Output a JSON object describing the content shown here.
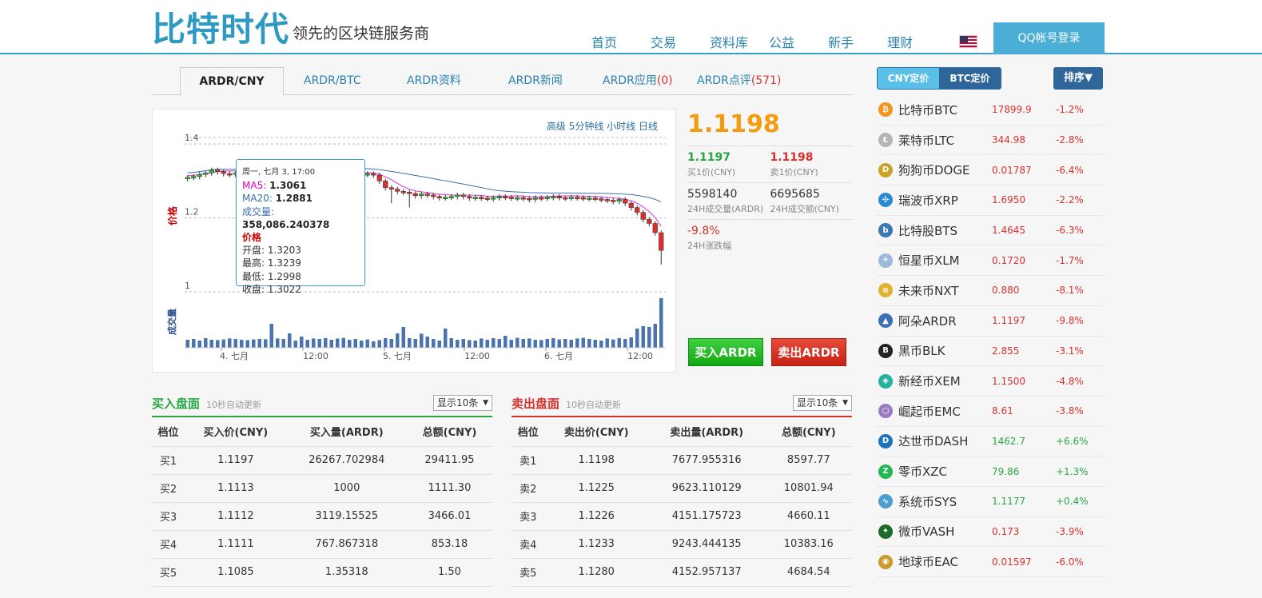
{
  "header": {
    "logo_main": "比特时代",
    "logo_sub": "领先的区块链服务商",
    "nav": [
      "首页",
      "交易",
      "资料库",
      "公益",
      "新手",
      "理财"
    ],
    "login_label": "QQ帐号登录"
  },
  "tabs": [
    {
      "label": "ARDR/CNY",
      "count": ""
    },
    {
      "label": "ARDR/BTC",
      "count": ""
    },
    {
      "label": "ARDR资料",
      "count": ""
    },
    {
      "label": "ARDR新闻",
      "count": ""
    },
    {
      "label": "ARDR应用",
      "count": "(0)"
    },
    {
      "label": "ARDR点评",
      "count": "(571)"
    }
  ],
  "chart": {
    "modes": "高级 5分钟线 小时线 日线",
    "price_axis_label": "价格",
    "volume_axis_label": "成交量",
    "tooltip": {
      "date": "周一, 七月 3, 17:00",
      "ma5_label": "MA5:",
      "ma5": "1.3061",
      "ma20_label": "MA20:",
      "ma20": "1.2881",
      "volume_label": "成交量:",
      "volume": "358,086.240378",
      "price_title": "价格",
      "open": "开盘: 1.3203",
      "high": "最高: 1.3239",
      "low": "最低: 1.2998",
      "close": "收盘: 1.3022"
    }
  },
  "chart_data": {
    "type": "candlestick",
    "title": "",
    "y_ticks": [
      1,
      1.2,
      1.4
    ],
    "ylim": [
      1.0,
      1.45
    ],
    "x_ticks": [
      "4. 七月",
      "12:00",
      "5. 七月",
      "12:00",
      "6. 七月",
      "12:00"
    ],
    "ma_series": [
      {
        "name": "MA5",
        "color": "#dd33cc"
      },
      {
        "name": "MA20",
        "color": "#3a6fb0"
      }
    ],
    "close": [
      1.31,
      1.312,
      1.318,
      1.322,
      1.33,
      1.325,
      1.32,
      1.318,
      1.322,
      1.326,
      1.33,
      1.334,
      1.332,
      1.33,
      1.328,
      1.325,
      1.322,
      1.32,
      1.318,
      1.32,
      1.322,
      1.318,
      1.315,
      1.312,
      1.316,
      1.318,
      1.32,
      1.318,
      1.316,
      1.318,
      1.32,
      1.316,
      1.3,
      1.282,
      1.278,
      1.272,
      1.27,
      1.266,
      1.26,
      1.265,
      1.262,
      1.258,
      1.255,
      1.256,
      1.258,
      1.262,
      1.258,
      1.254,
      1.256,
      1.254,
      1.252,
      1.255,
      1.258,
      1.256,
      1.254,
      1.255,
      1.253,
      1.25,
      1.255,
      1.254,
      1.256,
      1.258,
      1.255,
      1.254,
      1.256,
      1.255,
      1.253,
      1.254,
      1.252,
      1.25,
      1.248,
      1.245,
      1.25,
      1.24,
      1.228,
      1.215,
      1.196,
      1.185,
      1.16,
      1.112
    ],
    "volume": [
      50,
      55,
      45,
      60,
      50,
      48,
      52,
      58,
      55,
      50,
      48,
      52,
      55,
      53,
      150,
      58,
      55,
      90,
      45,
      70,
      50,
      58,
      55,
      60,
      50,
      58,
      62,
      50,
      55,
      45,
      52,
      40,
      48,
      60,
      55,
      90,
      130,
      60,
      55,
      88,
      70,
      55,
      45,
      120,
      60,
      50,
      55,
      48,
      45,
      58,
      50,
      60,
      55,
      75,
      50,
      62,
      55,
      58,
      50,
      48,
      55,
      60,
      52,
      55,
      50,
      58,
      62,
      55,
      50,
      45,
      58,
      52,
      60,
      55,
      65,
      120,
      135,
      130,
      150,
      310
    ]
  },
  "price_panel": {
    "last": "1.1198",
    "bid": "1.1197",
    "bid_label": "买1价(CNY)",
    "ask": "1.1198",
    "ask_label": "卖1价(CNY)",
    "vol": "5598140",
    "vol_label": "24H成交量(ARDR)",
    "amt": "6695685",
    "amt_label": "24H成交额(CNY)",
    "change": "-9.8%",
    "change_label": "24H涨跌幅",
    "buy_button": "买入ARDR",
    "sell_button": "卖出ARDR"
  },
  "buy_book": {
    "title": "买入盘面",
    "note": "10秒自动更新",
    "select": "显示10条",
    "headers": [
      "档位",
      "买入价(CNY)",
      "买入量(ARDR)",
      "总额(CNY)"
    ],
    "rows": [
      [
        "买1",
        "1.1197",
        "26267.702984",
        "29411.95"
      ],
      [
        "买2",
        "1.1113",
        "1000",
        "1111.30"
      ],
      [
        "买3",
        "1.1112",
        "3119.15525",
        "3466.01"
      ],
      [
        "买4",
        "1.1111",
        "767.867318",
        "853.18"
      ],
      [
        "买5",
        "1.1085",
        "1.35318",
        "1.50"
      ]
    ]
  },
  "sell_book": {
    "title": "卖出盘面",
    "note": "10秒自动更新",
    "select": "显示10条",
    "headers": [
      "档位",
      "卖出价(CNY)",
      "卖出量(ARDR)",
      "总额(CNY)"
    ],
    "rows": [
      [
        "卖1",
        "1.1198",
        "7677.955316",
        "8597.77"
      ],
      [
        "卖2",
        "1.1225",
        "9623.110129",
        "10801.94"
      ],
      [
        "卖3",
        "1.1226",
        "4151.175723",
        "4660.11"
      ],
      [
        "卖4",
        "1.1233",
        "9243.444135",
        "10383.16"
      ],
      [
        "卖5",
        "1.1280",
        "4152.957137",
        "4684.54"
      ]
    ]
  },
  "sidebar": {
    "toggle": [
      "CNY定价",
      "BTC定价"
    ],
    "sort_label": "排序▼",
    "coins": [
      {
        "name": "比特币BTC",
        "price": "17899.9",
        "change": "-1.2%",
        "up": false,
        "icon": "bitcoin-icon",
        "color": "#f7931a",
        "glyph": "₿"
      },
      {
        "name": "莱特币LTC",
        "price": "344.98",
        "change": "-2.8%",
        "up": false,
        "icon": "litecoin-icon",
        "color": "#b5b5b5",
        "glyph": "Ł"
      },
      {
        "name": "狗狗币DOGE",
        "price": "0.01787",
        "change": "-6.4%",
        "up": false,
        "icon": "dogecoin-icon",
        "color": "#c9a227",
        "glyph": "D"
      },
      {
        "name": "瑞波币XRP",
        "price": "1.6950",
        "change": "-2.2%",
        "up": false,
        "icon": "ripple-icon",
        "color": "#2a8ad4",
        "glyph": "✣"
      },
      {
        "name": "比特股BTS",
        "price": "1.4645",
        "change": "-6.3%",
        "up": false,
        "icon": "bitshares-icon",
        "color": "#3778b5",
        "glyph": "b"
      },
      {
        "name": "恒星币XLM",
        "price": "0.1720",
        "change": "-1.7%",
        "up": false,
        "icon": "stellar-icon",
        "color": "#9ab8d8",
        "glyph": "✈"
      },
      {
        "name": "未来币NXT",
        "price": "0.880",
        "change": "-8.1%",
        "up": false,
        "icon": "nxt-icon",
        "color": "#e0b030",
        "glyph": "≋"
      },
      {
        "name": "阿朵ARDR",
        "price": "1.1197",
        "change": "-9.8%",
        "up": false,
        "icon": "ardor-icon",
        "color": "#3d6fb5",
        "glyph": "▲"
      },
      {
        "name": "黑币BLK",
        "price": "2.855",
        "change": "-3.1%",
        "up": false,
        "icon": "blackcoin-icon",
        "color": "#222222",
        "glyph": "B"
      },
      {
        "name": "新经币XEM",
        "price": "1.1500",
        "change": "-4.8%",
        "up": false,
        "icon": "nem-icon",
        "color": "#25b19c",
        "glyph": "◈"
      },
      {
        "name": "崛起币EMC",
        "price": "8.61",
        "change": "-3.8%",
        "up": false,
        "icon": "emercoin-icon",
        "color": "#9b7bc0",
        "glyph": "⬡"
      },
      {
        "name": "达世币DASH",
        "price": "1462.7",
        "change": "+6.6%",
        "up": true,
        "icon": "dash-icon",
        "color": "#1c75bc",
        "glyph": "D"
      },
      {
        "name": "零币XZC",
        "price": "79.86",
        "change": "+1.3%",
        "up": true,
        "icon": "zcoin-icon",
        "color": "#23b852",
        "glyph": "Z"
      },
      {
        "name": "系统币SYS",
        "price": "1.1177",
        "change": "+0.4%",
        "up": true,
        "icon": "syscoin-icon",
        "color": "#4a9ed0",
        "glyph": "∿"
      },
      {
        "name": "微币VASH",
        "price": "0.173",
        "change": "-3.9%",
        "up": false,
        "icon": "vpncoin-icon",
        "color": "#1d6b2a",
        "glyph": "✦"
      },
      {
        "name": "地球币EAC",
        "price": "0.01597",
        "change": "-6.0%",
        "up": false,
        "icon": "earthcoin-icon",
        "color": "#c99a2a",
        "glyph": "◉"
      }
    ]
  }
}
